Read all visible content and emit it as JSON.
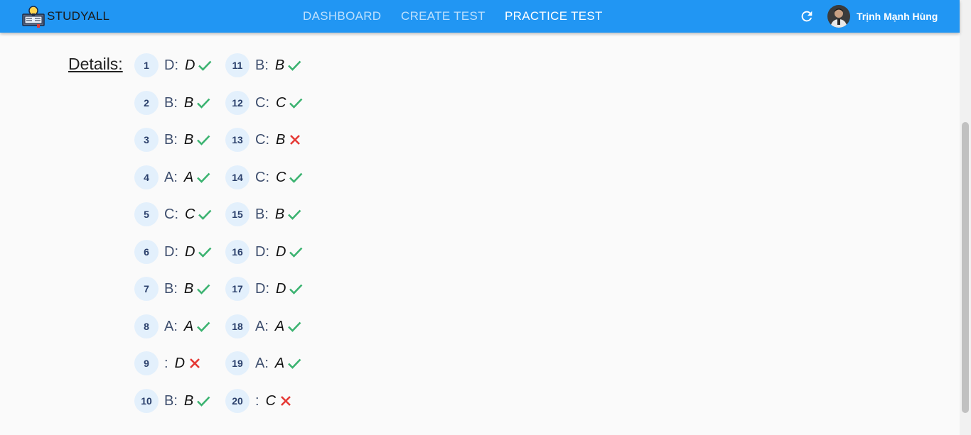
{
  "app": {
    "brand": "STUDYALL",
    "colors": {
      "primary": "#2196f3",
      "correct": "#3cb371",
      "wrong": "#e53935"
    }
  },
  "nav": {
    "dashboard": "DASHBOARD",
    "create_test": "CREATE TEST",
    "practice_test": "PRACTICE TEST",
    "active": "practice_test"
  },
  "user": {
    "name": "Trịnh Mạnh Hùng",
    "avatar_icon": "avatar"
  },
  "details": {
    "label": "Details:",
    "answers": [
      {
        "num": "1",
        "chosen": "D:",
        "correct": "D",
        "ok": true
      },
      {
        "num": "2",
        "chosen": "B:",
        "correct": "B",
        "ok": true
      },
      {
        "num": "3",
        "chosen": "B:",
        "correct": "B",
        "ok": true
      },
      {
        "num": "4",
        "chosen": "A:",
        "correct": "A",
        "ok": true
      },
      {
        "num": "5",
        "chosen": "C:",
        "correct": "C",
        "ok": true
      },
      {
        "num": "6",
        "chosen": "D:",
        "correct": "D",
        "ok": true
      },
      {
        "num": "7",
        "chosen": "B:",
        "correct": "B",
        "ok": true
      },
      {
        "num": "8",
        "chosen": "A:",
        "correct": "A",
        "ok": true
      },
      {
        "num": "9",
        "chosen": ":",
        "correct": "D",
        "ok": false
      },
      {
        "num": "10",
        "chosen": "B:",
        "correct": "B",
        "ok": true
      },
      {
        "num": "11",
        "chosen": "B:",
        "correct": "B",
        "ok": true
      },
      {
        "num": "12",
        "chosen": "C:",
        "correct": "C",
        "ok": true
      },
      {
        "num": "13",
        "chosen": "C:",
        "correct": "B",
        "ok": false
      },
      {
        "num": "14",
        "chosen": "C:",
        "correct": "C",
        "ok": true
      },
      {
        "num": "15",
        "chosen": "B:",
        "correct": "B",
        "ok": true
      },
      {
        "num": "16",
        "chosen": "D:",
        "correct": "D",
        "ok": true
      },
      {
        "num": "17",
        "chosen": "D:",
        "correct": "D",
        "ok": true
      },
      {
        "num": "18",
        "chosen": "A:",
        "correct": "A",
        "ok": true
      },
      {
        "num": "19",
        "chosen": "A:",
        "correct": "A",
        "ok": true
      },
      {
        "num": "20",
        "chosen": ":",
        "correct": "C",
        "ok": false
      }
    ]
  }
}
